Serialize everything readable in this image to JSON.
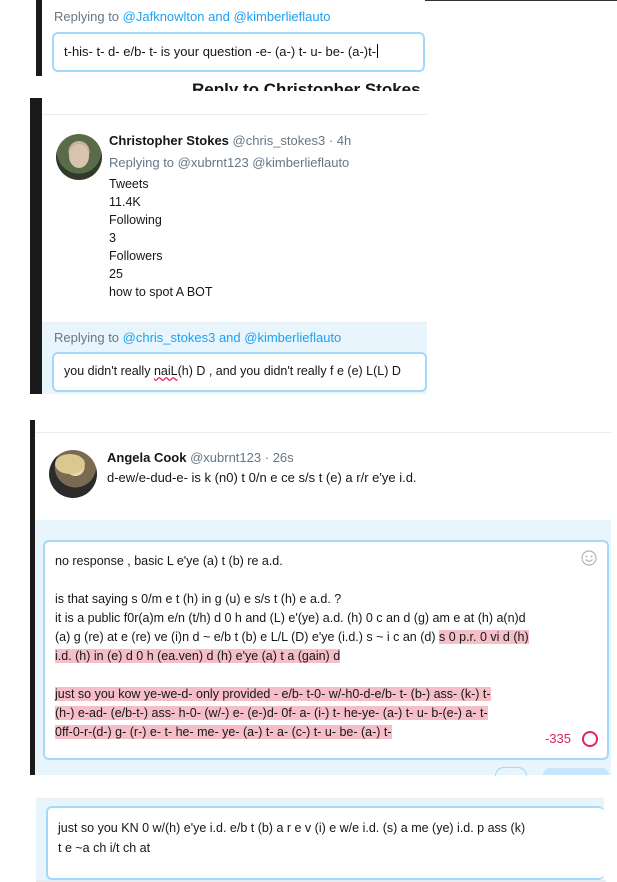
{
  "section1": {
    "replying_prefix": "Replying to ",
    "mention1": "@Jafknowlton",
    "and": " and ",
    "mention2": "@kimberlieflauto",
    "compose_text": "t-his- t- d- e/b- t- is your question -e- (a-) t- u- be- (a-)t-"
  },
  "section2": {
    "header_title": "Reply to Christopher Stokes",
    "name": "Christopher Stokes",
    "handle": "@chris_stokes3",
    "dot": " · ",
    "time": "4h",
    "replying_to_line": "Replying to @xubrnt123 @kimberlieflauto",
    "lines": [
      "Tweets",
      "11.4K",
      "Following",
      "3",
      "Followers",
      "25",
      "how to spot A BOT"
    ],
    "reply_prefix": "Replying to ",
    "reply_mention1": "@chris_stokes3",
    "reply_and": " and ",
    "reply_mention2": "@kimberlieflauto",
    "compose_pre": "you didn't really ",
    "compose_misspelled": "naiL",
    "compose_post": "(h) D , and you didn't really f e (e) L(L) D"
  },
  "section3": {
    "name": "Angela Cook",
    "handle": "@xubrnt123",
    "dot": " · ",
    "time": "26s",
    "tweet_text": "d-ew/e-dud-e-  is k (n0) t 0/n e ce s/s t (e) a r/r e'ye i.d.",
    "compose": {
      "line1": "no response , basic L e'ye (a) t (b) re a.d.",
      "line2": "is that saying s 0/m e t (h) in g (u) e s/s t (h) e a.d. ?",
      "line3": "it is a public f0r(a)m e/n (t/h) d 0 h and (L) e'(ye) a.d. (h) 0 c an d (g) am e at (h) a(n)d",
      "line4_plain": "(a) g (re) at e (re) ve (i)n d  ~ e/b t (b) e L/L (D) e'ye (i.d.) s ~ i c an (d) ",
      "line4_hl": "s 0 p.r. 0 vi d (h)",
      "line5_hl": "i.d. (h) in (e) d 0 h (ea.ven) d (h) e'ye (a) t a (gain) d",
      "line6_hl": "just so you kow  ye-we-d- only provided - e/b- t-0- w/-h0-d-e/b- t- (b-) ass- (k-) t-",
      "line7_hl": "(h-) e-ad- (e/b-t-) ass- h-0- (w/-) e-  (e-)d- 0f- a- (i-) t- he-ye- (a-) t-  u- b-(e-) a- t-",
      "line8_hl": "0ff-0-r-(d-) g- (r-) e- t- he- me- ye- (a-) t- a- (c-) t- u- be- (a-) t-"
    },
    "char_count": "-335",
    "emoji_icon": "smiley-icon",
    "progress_icon": "circle-progress-icon",
    "accent": "#1da1f2",
    "warning": "#e0245e"
  },
  "section4": {
    "line1": "just so you KN 0 w/(h) e'ye i.d. e/b t (b) a r e v (i) e w/e i.d. (s) a me (ye) i.d. p ass (k)",
    "line2": "t e ~a ch i/t ch at"
  }
}
